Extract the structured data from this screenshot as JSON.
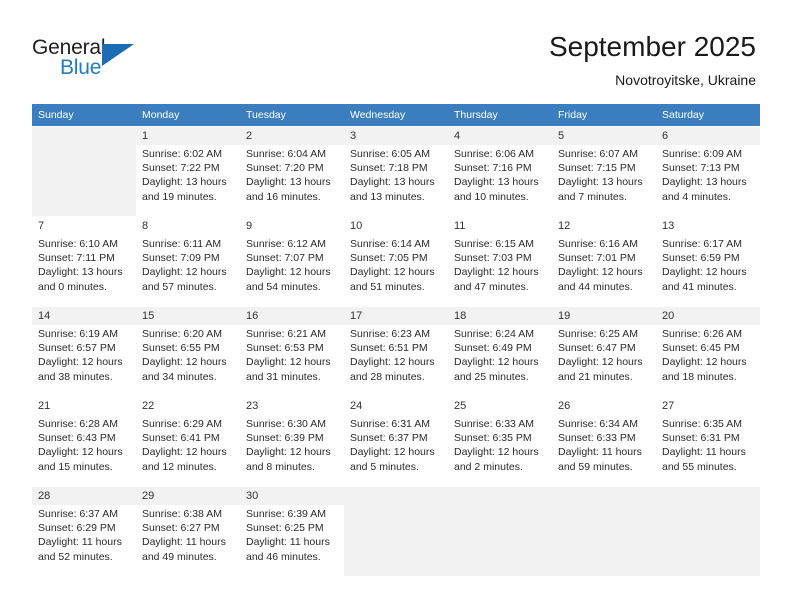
{
  "brand": {
    "name_top": "General",
    "name_bottom": "Blue",
    "accent_color": "#1b6cb3",
    "triangle_icon": "triangle-icon"
  },
  "header": {
    "title": "September 2025",
    "subtitle": "Novotroyitske, Ukraine"
  },
  "calendar": {
    "header_bg": "#3a7ebf",
    "shaded_row_bg": "#f2f2f2",
    "weekdays": [
      "Sunday",
      "Monday",
      "Tuesday",
      "Wednesday",
      "Thursday",
      "Friday",
      "Saturday"
    ],
    "weeks": [
      [
        {
          "day": "",
          "sunrise": "",
          "sunset": "",
          "daylight": "",
          "empty": true
        },
        {
          "day": "1",
          "sunrise": "Sunrise: 6:02 AM",
          "sunset": "Sunset: 7:22 PM",
          "daylight": "Daylight: 13 hours and 19 minutes."
        },
        {
          "day": "2",
          "sunrise": "Sunrise: 6:04 AM",
          "sunset": "Sunset: 7:20 PM",
          "daylight": "Daylight: 13 hours and 16 minutes."
        },
        {
          "day": "3",
          "sunrise": "Sunrise: 6:05 AM",
          "sunset": "Sunset: 7:18 PM",
          "daylight": "Daylight: 13 hours and 13 minutes."
        },
        {
          "day": "4",
          "sunrise": "Sunrise: 6:06 AM",
          "sunset": "Sunset: 7:16 PM",
          "daylight": "Daylight: 13 hours and 10 minutes."
        },
        {
          "day": "5",
          "sunrise": "Sunrise: 6:07 AM",
          "sunset": "Sunset: 7:15 PM",
          "daylight": "Daylight: 13 hours and 7 minutes."
        },
        {
          "day": "6",
          "sunrise": "Sunrise: 6:09 AM",
          "sunset": "Sunset: 7:13 PM",
          "daylight": "Daylight: 13 hours and 4 minutes."
        }
      ],
      [
        {
          "day": "7",
          "sunrise": "Sunrise: 6:10 AM",
          "sunset": "Sunset: 7:11 PM",
          "daylight": "Daylight: 13 hours and 0 minutes."
        },
        {
          "day": "8",
          "sunrise": "Sunrise: 6:11 AM",
          "sunset": "Sunset: 7:09 PM",
          "daylight": "Daylight: 12 hours and 57 minutes."
        },
        {
          "day": "9",
          "sunrise": "Sunrise: 6:12 AM",
          "sunset": "Sunset: 7:07 PM",
          "daylight": "Daylight: 12 hours and 54 minutes."
        },
        {
          "day": "10",
          "sunrise": "Sunrise: 6:14 AM",
          "sunset": "Sunset: 7:05 PM",
          "daylight": "Daylight: 12 hours and 51 minutes."
        },
        {
          "day": "11",
          "sunrise": "Sunrise: 6:15 AM",
          "sunset": "Sunset: 7:03 PM",
          "daylight": "Daylight: 12 hours and 47 minutes."
        },
        {
          "day": "12",
          "sunrise": "Sunrise: 6:16 AM",
          "sunset": "Sunset: 7:01 PM",
          "daylight": "Daylight: 12 hours and 44 minutes."
        },
        {
          "day": "13",
          "sunrise": "Sunrise: 6:17 AM",
          "sunset": "Sunset: 6:59 PM",
          "daylight": "Daylight: 12 hours and 41 minutes."
        }
      ],
      [
        {
          "day": "14",
          "sunrise": "Sunrise: 6:19 AM",
          "sunset": "Sunset: 6:57 PM",
          "daylight": "Daylight: 12 hours and 38 minutes."
        },
        {
          "day": "15",
          "sunrise": "Sunrise: 6:20 AM",
          "sunset": "Sunset: 6:55 PM",
          "daylight": "Daylight: 12 hours and 34 minutes."
        },
        {
          "day": "16",
          "sunrise": "Sunrise: 6:21 AM",
          "sunset": "Sunset: 6:53 PM",
          "daylight": "Daylight: 12 hours and 31 minutes."
        },
        {
          "day": "17",
          "sunrise": "Sunrise: 6:23 AM",
          "sunset": "Sunset: 6:51 PM",
          "daylight": "Daylight: 12 hours and 28 minutes."
        },
        {
          "day": "18",
          "sunrise": "Sunrise: 6:24 AM",
          "sunset": "Sunset: 6:49 PM",
          "daylight": "Daylight: 12 hours and 25 minutes."
        },
        {
          "day": "19",
          "sunrise": "Sunrise: 6:25 AM",
          "sunset": "Sunset: 6:47 PM",
          "daylight": "Daylight: 12 hours and 21 minutes."
        },
        {
          "day": "20",
          "sunrise": "Sunrise: 6:26 AM",
          "sunset": "Sunset: 6:45 PM",
          "daylight": "Daylight: 12 hours and 18 minutes."
        }
      ],
      [
        {
          "day": "21",
          "sunrise": "Sunrise: 6:28 AM",
          "sunset": "Sunset: 6:43 PM",
          "daylight": "Daylight: 12 hours and 15 minutes."
        },
        {
          "day": "22",
          "sunrise": "Sunrise: 6:29 AM",
          "sunset": "Sunset: 6:41 PM",
          "daylight": "Daylight: 12 hours and 12 minutes."
        },
        {
          "day": "23",
          "sunrise": "Sunrise: 6:30 AM",
          "sunset": "Sunset: 6:39 PM",
          "daylight": "Daylight: 12 hours and 8 minutes."
        },
        {
          "day": "24",
          "sunrise": "Sunrise: 6:31 AM",
          "sunset": "Sunset: 6:37 PM",
          "daylight": "Daylight: 12 hours and 5 minutes."
        },
        {
          "day": "25",
          "sunrise": "Sunrise: 6:33 AM",
          "sunset": "Sunset: 6:35 PM",
          "daylight": "Daylight: 12 hours and 2 minutes."
        },
        {
          "day": "26",
          "sunrise": "Sunrise: 6:34 AM",
          "sunset": "Sunset: 6:33 PM",
          "daylight": "Daylight: 11 hours and 59 minutes."
        },
        {
          "day": "27",
          "sunrise": "Sunrise: 6:35 AM",
          "sunset": "Sunset: 6:31 PM",
          "daylight": "Daylight: 11 hours and 55 minutes."
        }
      ],
      [
        {
          "day": "28",
          "sunrise": "Sunrise: 6:37 AM",
          "sunset": "Sunset: 6:29 PM",
          "daylight": "Daylight: 11 hours and 52 minutes."
        },
        {
          "day": "29",
          "sunrise": "Sunrise: 6:38 AM",
          "sunset": "Sunset: 6:27 PM",
          "daylight": "Daylight: 11 hours and 49 minutes."
        },
        {
          "day": "30",
          "sunrise": "Sunrise: 6:39 AM",
          "sunset": "Sunset: 6:25 PM",
          "daylight": "Daylight: 11 hours and 46 minutes."
        },
        {
          "day": "",
          "sunrise": "",
          "sunset": "",
          "daylight": "",
          "empty": true
        },
        {
          "day": "",
          "sunrise": "",
          "sunset": "",
          "daylight": "",
          "empty": true
        },
        {
          "day": "",
          "sunrise": "",
          "sunset": "",
          "daylight": "",
          "empty": true
        },
        {
          "day": "",
          "sunrise": "",
          "sunset": "",
          "daylight": "",
          "empty": true
        }
      ]
    ]
  }
}
